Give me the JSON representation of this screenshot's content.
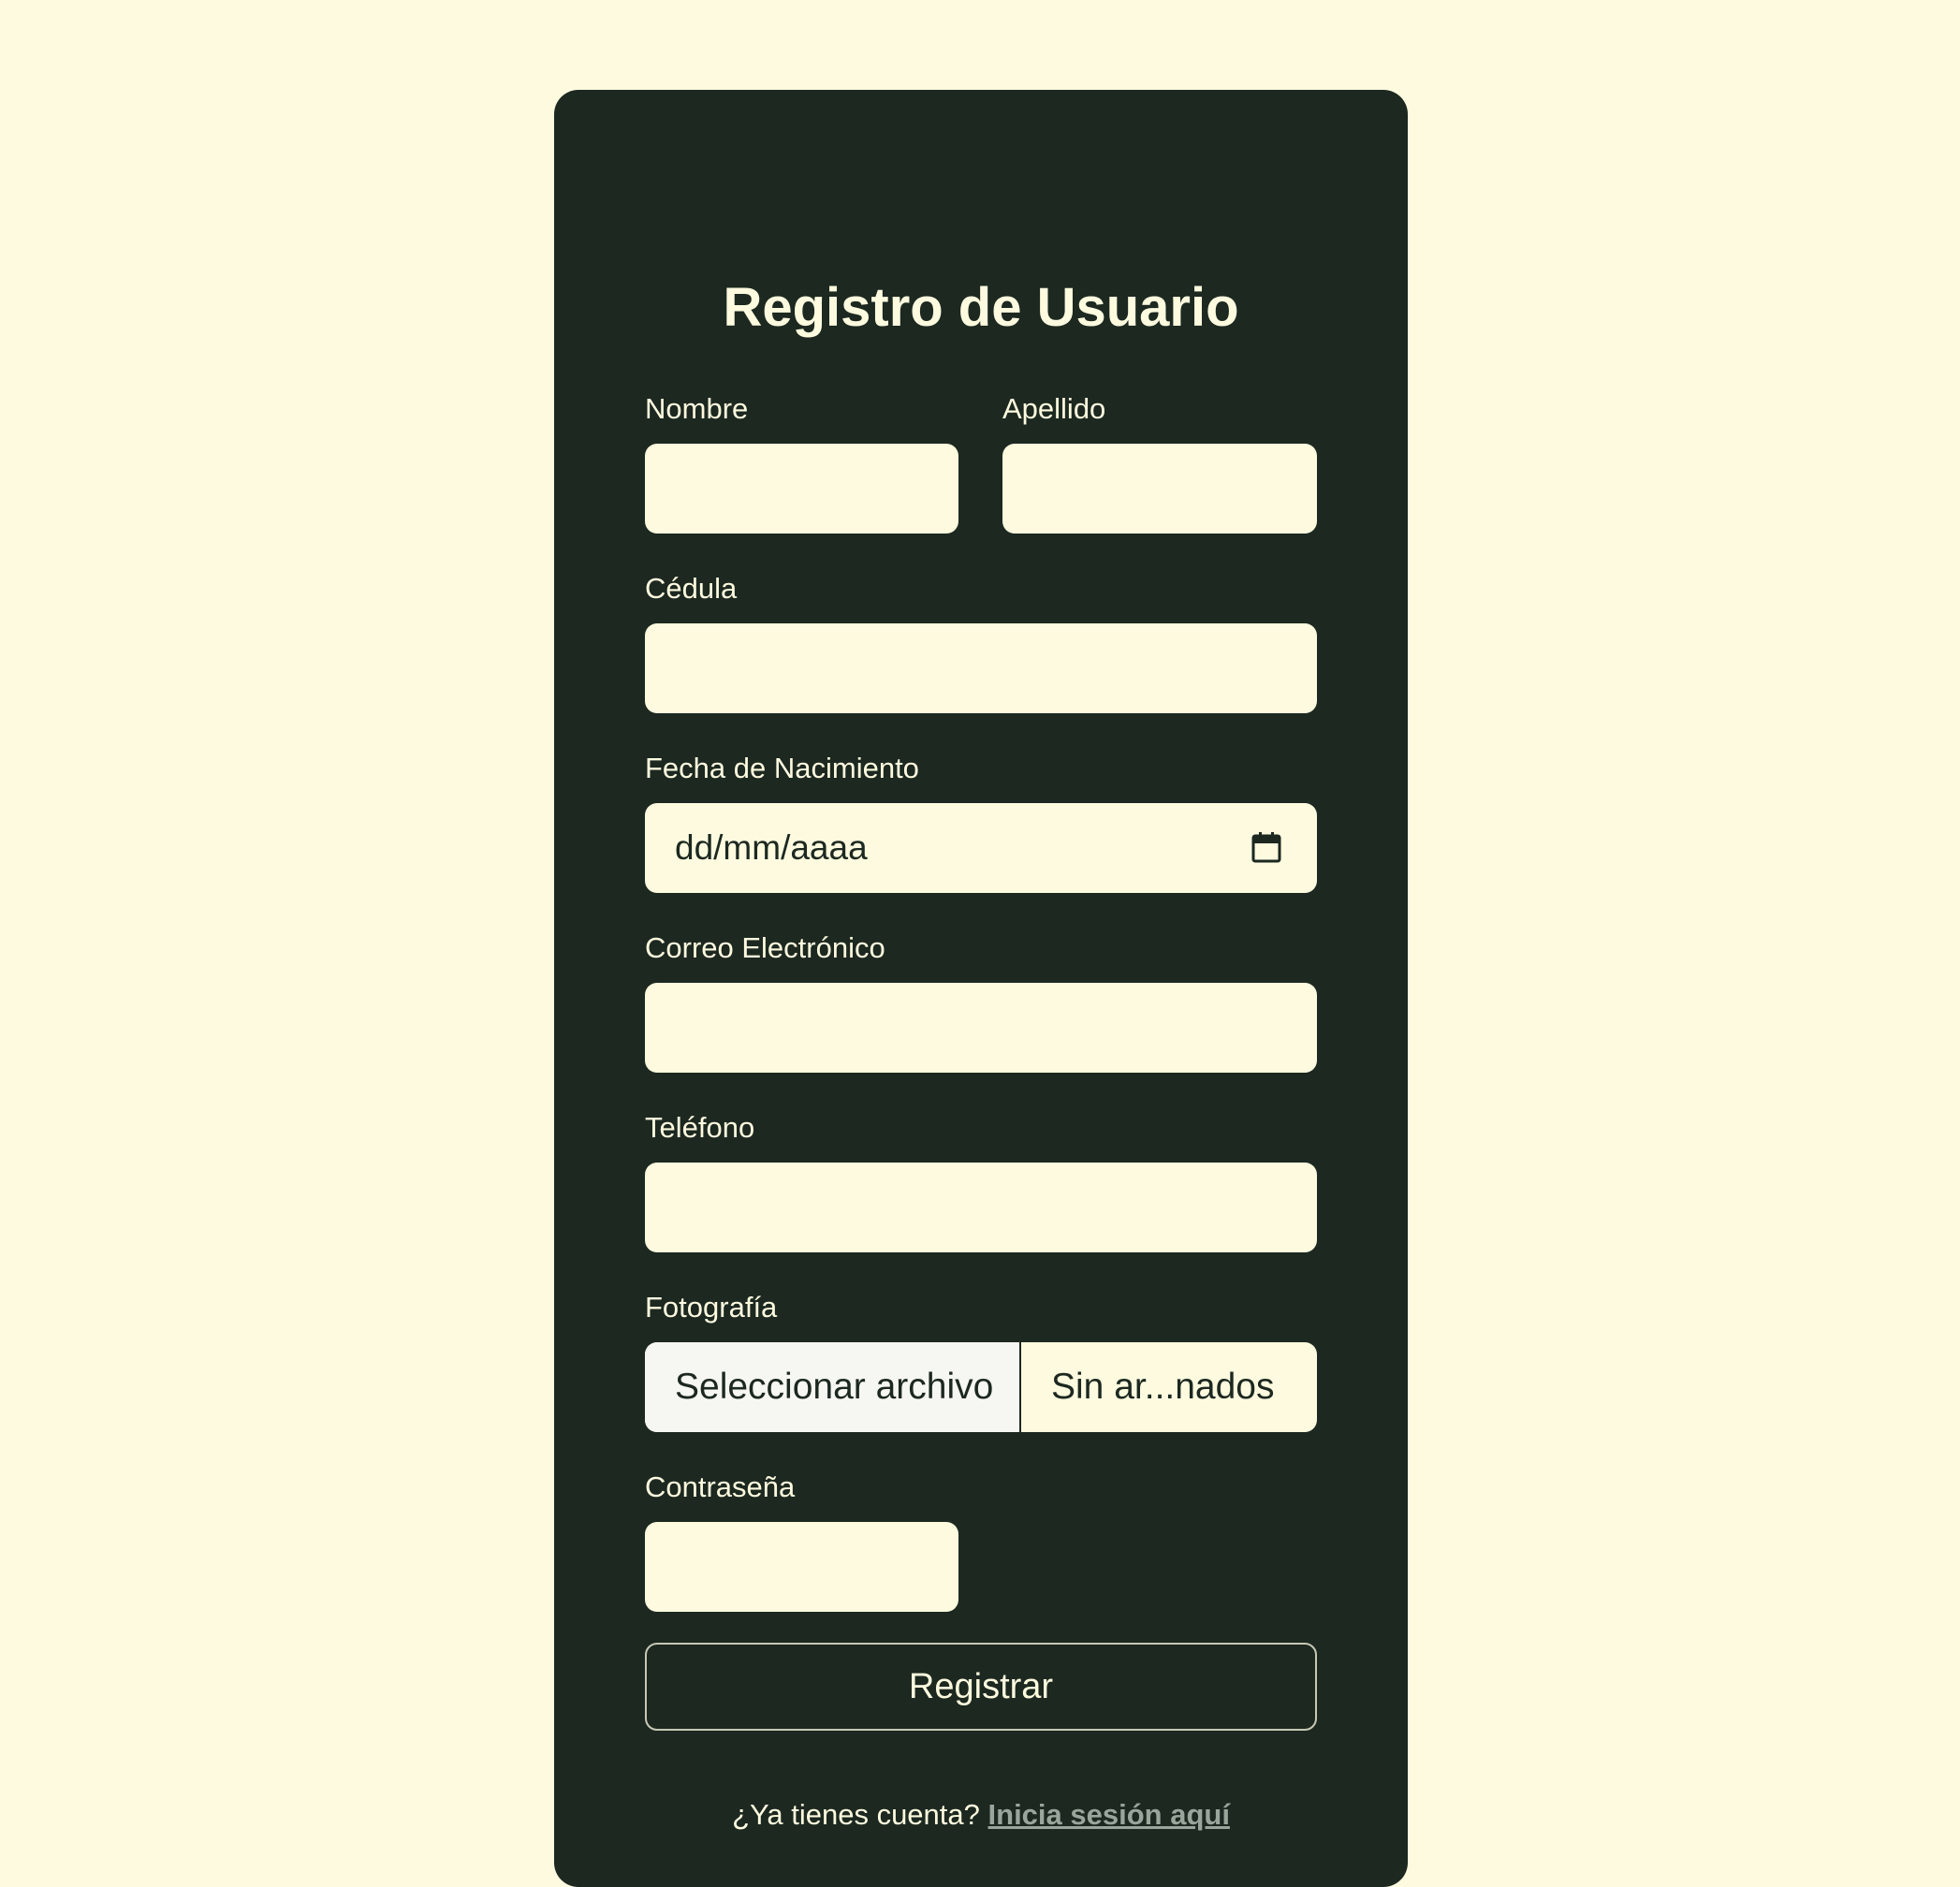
{
  "form": {
    "title": "Registro de Usuario",
    "fields": {
      "nombre": {
        "label": "Nombre",
        "value": ""
      },
      "apellido": {
        "label": "Apellido",
        "value": ""
      },
      "cedula": {
        "label": "Cédula",
        "value": ""
      },
      "fecha": {
        "label": "Fecha de Nacimiento",
        "placeholder": "dd/mm/aaaa"
      },
      "correo": {
        "label": "Correo Electrónico",
        "value": ""
      },
      "telefono": {
        "label": "Teléfono",
        "value": ""
      },
      "fotografia": {
        "label": "Fotografía",
        "button_label": "Seleccionar archivo",
        "status": "Sin ar...nados"
      },
      "contrasena": {
        "label": "Contraseña",
        "value": ""
      }
    },
    "submit_label": "Registrar",
    "footer": {
      "text": "¿Ya tienes cuenta?",
      "link_label": "Inicia sesión aquí"
    }
  },
  "colors": {
    "page_bg": "#fdfadf",
    "card_bg": "#1c2820",
    "field_bg": "#fdfadf",
    "link": "#9aa59b"
  },
  "icons": {
    "date_picker": "calendar-icon"
  }
}
